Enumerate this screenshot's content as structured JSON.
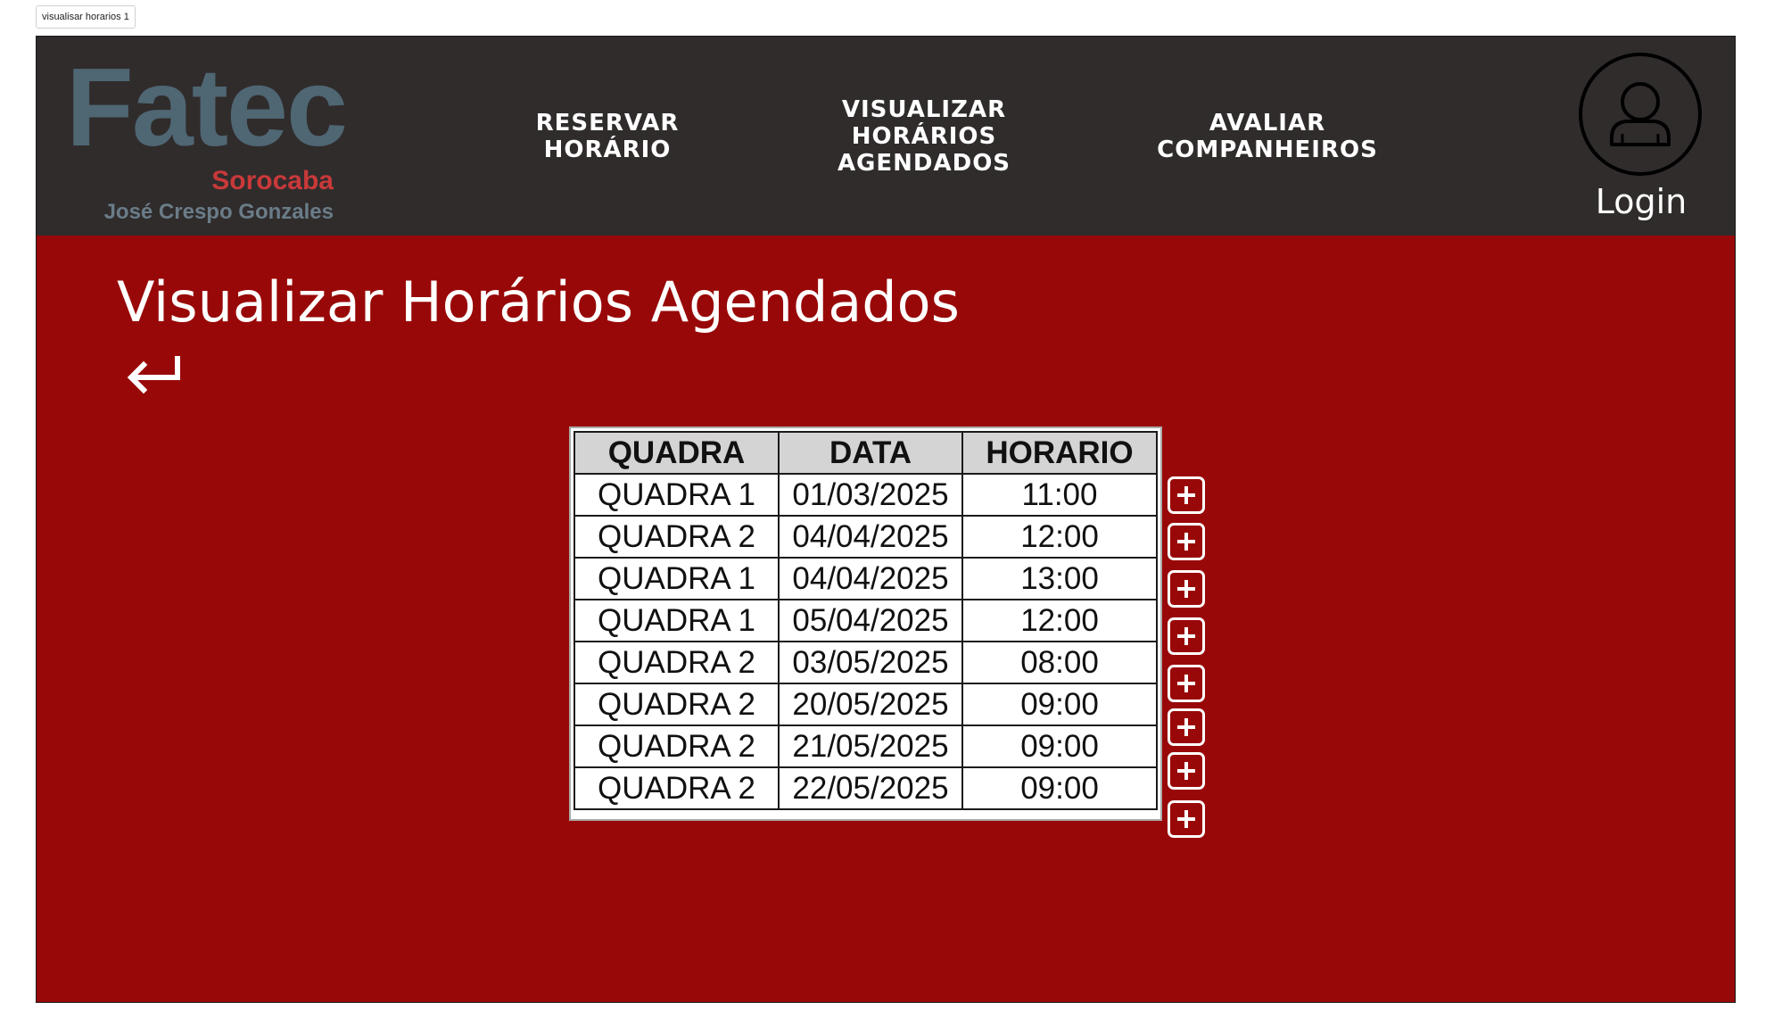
{
  "frame_label": "visualisar horarios 1",
  "header": {
    "logo": {
      "brand": "Fatec",
      "city": "Sorocaba",
      "name": "José Crespo Gonzales"
    },
    "nav": [
      {
        "label": "RESERVAR\nHORÁRIO"
      },
      {
        "label": "VISUALIZAR\nHORÁRIOS\nAGENDADOS"
      },
      {
        "label": "AVALIAR\nCOMPANHEIROS"
      }
    ],
    "login_label": "Login"
  },
  "main": {
    "title": "Visualizar Horários Agendados",
    "table": {
      "headers": [
        "QUADRA",
        "DATA",
        "HORARIO"
      ],
      "rows": [
        [
          "QUADRA 1",
          "01/03/2025",
          "11:00"
        ],
        [
          "QUADRA 2",
          "04/04/2025",
          "12:00"
        ],
        [
          "QUADRA 1",
          "04/04/2025",
          "13:00"
        ],
        [
          "QUADRA 1",
          "05/04/2025",
          "12:00"
        ],
        [
          "QUADRA 2",
          "03/05/2025",
          "08:00"
        ],
        [
          "QUADRA 2",
          "20/05/2025",
          "09:00"
        ],
        [
          "QUADRA 2",
          "21/05/2025",
          "09:00"
        ],
        [
          "QUADRA 2",
          "22/05/2025",
          "09:00"
        ]
      ]
    }
  },
  "icons": {
    "back": "return-arrow-icon",
    "add": "plus-square-icon",
    "user": "user-circle-icon"
  },
  "colors": {
    "page_background": "#990808",
    "header_background": "#302c2c",
    "logo_brand": "#4f6673",
    "logo_city": "#c9393a",
    "table_header": "#d4d4d4"
  }
}
